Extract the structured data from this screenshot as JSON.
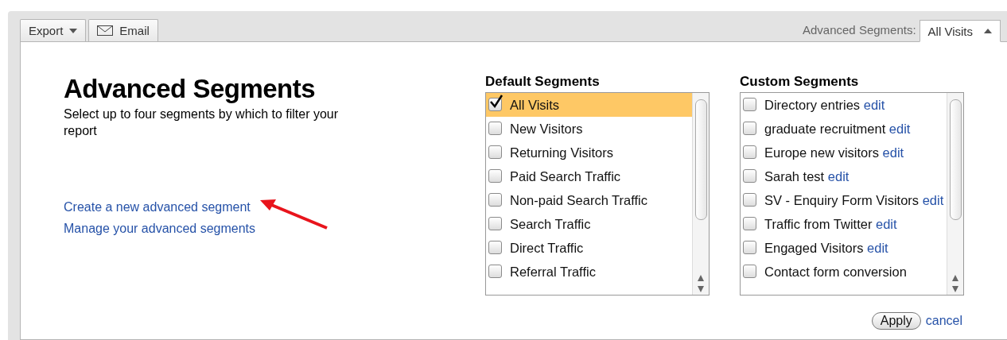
{
  "toolbar": {
    "export_label": "Export",
    "email_label": "Email",
    "segments_label": "Advanced Segments:",
    "segments_value": "All Visits"
  },
  "intro": {
    "title": "Advanced Segments",
    "description": "Select up to four segments by which to filter your report"
  },
  "links": [
    "Create a new advanced segment",
    "Manage your advanced segments"
  ],
  "default_segments": {
    "heading": "Default Segments",
    "items": [
      {
        "label": "All Visits",
        "checked": true,
        "selected": true
      },
      {
        "label": "New Visitors",
        "checked": false,
        "selected": false
      },
      {
        "label": "Returning Visitors",
        "checked": false,
        "selected": false
      },
      {
        "label": "Paid Search Traffic",
        "checked": false,
        "selected": false
      },
      {
        "label": "Non-paid Search Traffic",
        "checked": false,
        "selected": false
      },
      {
        "label": "Search Traffic",
        "checked": false,
        "selected": false
      },
      {
        "label": "Direct Traffic",
        "checked": false,
        "selected": false
      },
      {
        "label": "Referral Traffic",
        "checked": false,
        "selected": false
      }
    ]
  },
  "custom_segments": {
    "heading": "Custom Segments",
    "items": [
      {
        "label": "Directory entries",
        "edit": "edit",
        "checked": false
      },
      {
        "label": "graduate recruitment",
        "edit": "edit",
        "checked": false
      },
      {
        "label": "Europe new visitors",
        "edit": "edit",
        "checked": false
      },
      {
        "label": "Sarah test",
        "edit": "edit",
        "checked": false
      },
      {
        "label": "SV - Enquiry Form Visitors",
        "edit": "edit",
        "checked": false
      },
      {
        "label": "Traffic from Twitter",
        "edit": "edit",
        "checked": false
      },
      {
        "label": "Engaged Visitors",
        "edit": "edit",
        "checked": false
      },
      {
        "label": "Contact form conversion",
        "checked": false
      }
    ]
  },
  "actions": {
    "apply": "Apply",
    "cancel": "cancel"
  }
}
